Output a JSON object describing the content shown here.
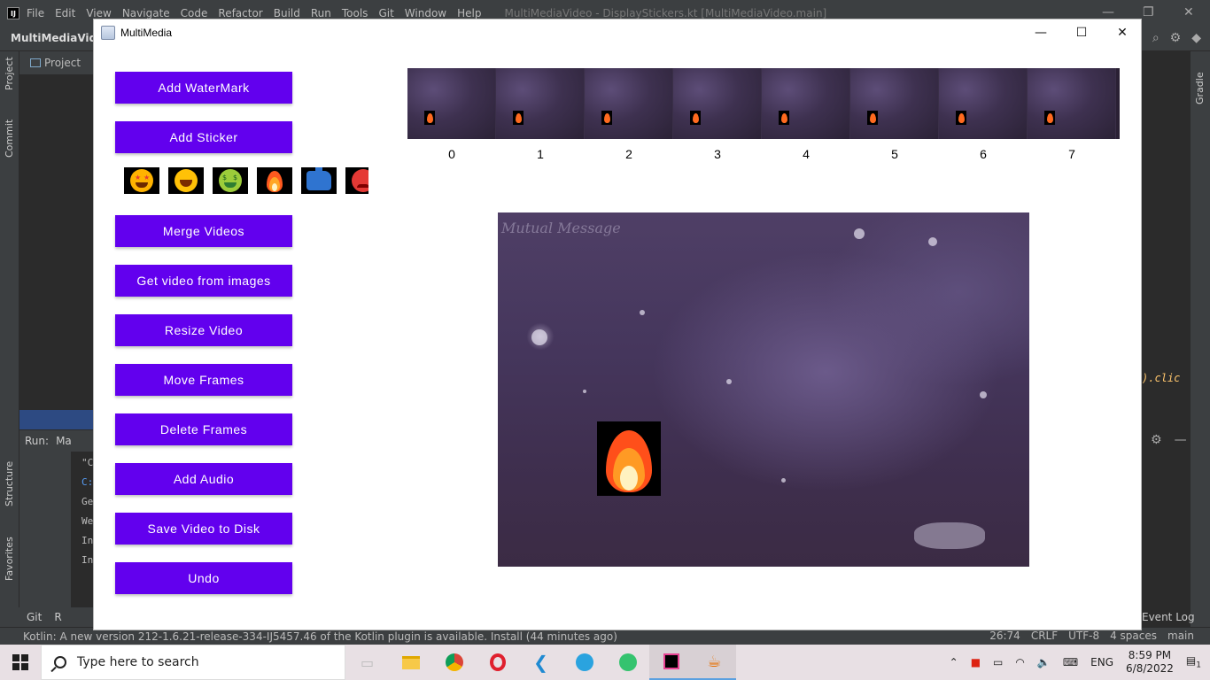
{
  "ide": {
    "menu": [
      "File",
      "Edit",
      "View",
      "Navigate",
      "Code",
      "Refactor",
      "Build",
      "Run",
      "Tools",
      "Git",
      "Window",
      "Help"
    ],
    "window_title": "MultiMediaVideo - DisplayStickers.kt [MultiMediaVideo.main]",
    "project_name": "MultiMediaVide",
    "project_tab": "Project",
    "left_tabs": [
      "Project",
      "Commit",
      "Structure",
      "Favorites"
    ],
    "right_tab": "Gradle",
    "run_label": "Run:",
    "run_config": "Ma",
    "console_lines": [
      "\"C",
      "C:",
      "Ge",
      "We",
      "In",
      "In"
    ],
    "code_fragment": ").clic",
    "bottom_tabs": [
      "Git",
      "R"
    ],
    "event_log": "Event Log",
    "status_message": "Kotlin: A new version 212-1.6.21-release-334-IJ5457.46 of the Kotlin plugin is available. Install (44 minutes ago)",
    "status_right": [
      "26:74",
      "CRLF",
      "UTF-8",
      "4 spaces",
      "main"
    ]
  },
  "taskbar": {
    "search_placeholder": "Type here to search",
    "language": "ENG",
    "time": "8:59 PM",
    "date": "6/8/2022",
    "notification_count": "1"
  },
  "window": {
    "title": "MultiMedia",
    "buttons": {
      "add_watermark": "Add WaterMark",
      "add_sticker": "Add Sticker",
      "merge_videos": "Merge Videos",
      "get_video_from_images": "Get video from images",
      "resize_video": "Resize Video",
      "move_frames": "Move Frames",
      "delete_frames": "Delete Frames",
      "add_audio": "Add Audio",
      "save_video": "Save Video to Disk",
      "undo": "Undo"
    },
    "stickers": [
      "star-struck",
      "laughing",
      "money-mouth",
      "fire",
      "thumbs-up",
      "angry"
    ],
    "frame_labels": [
      "0",
      "1",
      "2",
      "3",
      "4",
      "5",
      "6",
      "7"
    ],
    "preview_watermark": "Mutual Message",
    "accent_color": "#6200ee"
  }
}
